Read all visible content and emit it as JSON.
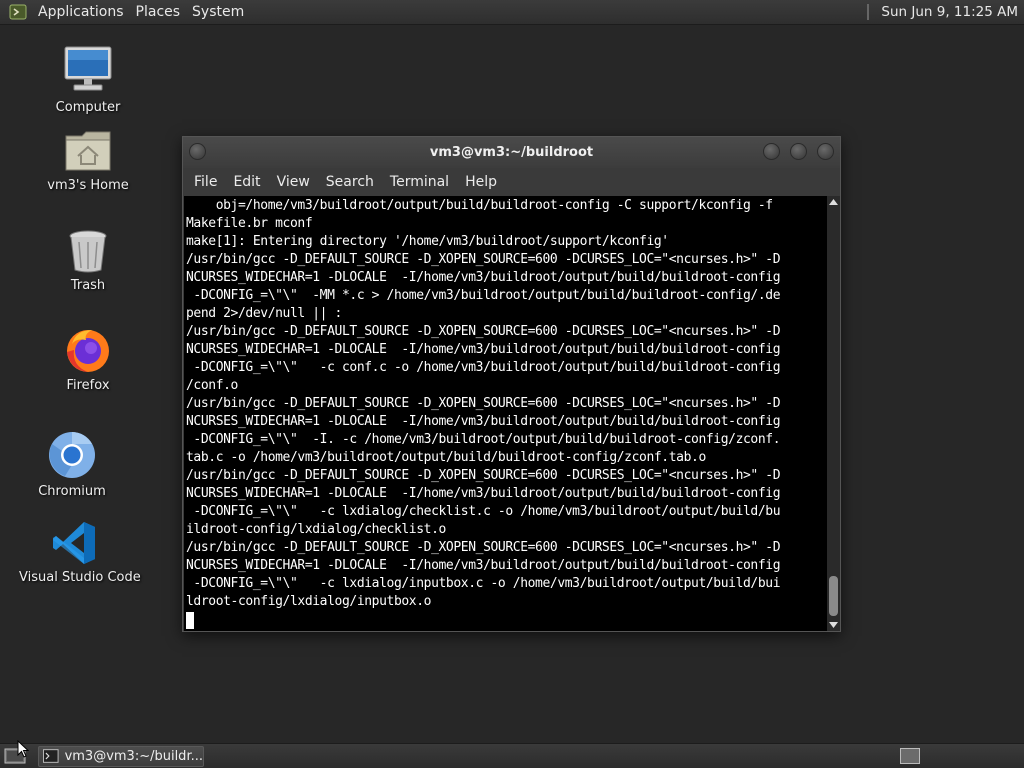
{
  "top_panel": {
    "menus": [
      "Applications",
      "Places",
      "System"
    ],
    "clock": "Sun Jun  9, 11:25 AM"
  },
  "desktop_icons": [
    {
      "label": "Computer",
      "icon": "computer-icon"
    },
    {
      "label": "vm3's Home",
      "icon": "home-folder-icon"
    },
    {
      "label": "Trash",
      "icon": "trash-icon"
    },
    {
      "label": "Firefox",
      "icon": "firefox-icon"
    },
    {
      "label": "Chromium",
      "icon": "chromium-icon"
    },
    {
      "label": "Visual Studio Code",
      "icon": "vscode-icon"
    }
  ],
  "terminal": {
    "title": "vm3@vm3:~/buildroot",
    "menu": [
      "File",
      "Edit",
      "View",
      "Search",
      "Terminal",
      "Help"
    ],
    "lines": [
      "    obj=/home/vm3/buildroot/output/build/buildroot-config -C support/kconfig -f",
      "Makefile.br mconf",
      "make[1]: Entering directory '/home/vm3/buildroot/support/kconfig'",
      "/usr/bin/gcc -D_DEFAULT_SOURCE -D_XOPEN_SOURCE=600 -DCURSES_LOC=\"<ncurses.h>\" -D",
      "NCURSES_WIDECHAR=1 -DLOCALE  -I/home/vm3/buildroot/output/build/buildroot-config",
      " -DCONFIG_=\\\"\\\"  -MM *.c > /home/vm3/buildroot/output/build/buildroot-config/.de",
      "pend 2>/dev/null || :",
      "/usr/bin/gcc -D_DEFAULT_SOURCE -D_XOPEN_SOURCE=600 -DCURSES_LOC=\"<ncurses.h>\" -D",
      "NCURSES_WIDECHAR=1 -DLOCALE  -I/home/vm3/buildroot/output/build/buildroot-config",
      " -DCONFIG_=\\\"\\\"   -c conf.c -o /home/vm3/buildroot/output/build/buildroot-config",
      "/conf.o",
      "/usr/bin/gcc -D_DEFAULT_SOURCE -D_XOPEN_SOURCE=600 -DCURSES_LOC=\"<ncurses.h>\" -D",
      "NCURSES_WIDECHAR=1 -DLOCALE  -I/home/vm3/buildroot/output/build/buildroot-config",
      " -DCONFIG_=\\\"\\\"  -I. -c /home/vm3/buildroot/output/build/buildroot-config/zconf.",
      "tab.c -o /home/vm3/buildroot/output/build/buildroot-config/zconf.tab.o",
      "/usr/bin/gcc -D_DEFAULT_SOURCE -D_XOPEN_SOURCE=600 -DCURSES_LOC=\"<ncurses.h>\" -D",
      "NCURSES_WIDECHAR=1 -DLOCALE  -I/home/vm3/buildroot/output/build/buildroot-config",
      " -DCONFIG_=\\\"\\\"   -c lxdialog/checklist.c -o /home/vm3/buildroot/output/build/bu",
      "ildroot-config/lxdialog/checklist.o",
      "/usr/bin/gcc -D_DEFAULT_SOURCE -D_XOPEN_SOURCE=600 -DCURSES_LOC=\"<ncurses.h>\" -D",
      "NCURSES_WIDECHAR=1 -DLOCALE  -I/home/vm3/buildroot/output/build/buildroot-config",
      " -DCONFIG_=\\\"\\\"   -c lxdialog/inputbox.c -o /home/vm3/buildroot/output/build/bui",
      "ldroot-config/lxdialog/inputbox.o"
    ]
  },
  "taskbar": {
    "task_label": "vm3@vm3:~/buildr..."
  }
}
